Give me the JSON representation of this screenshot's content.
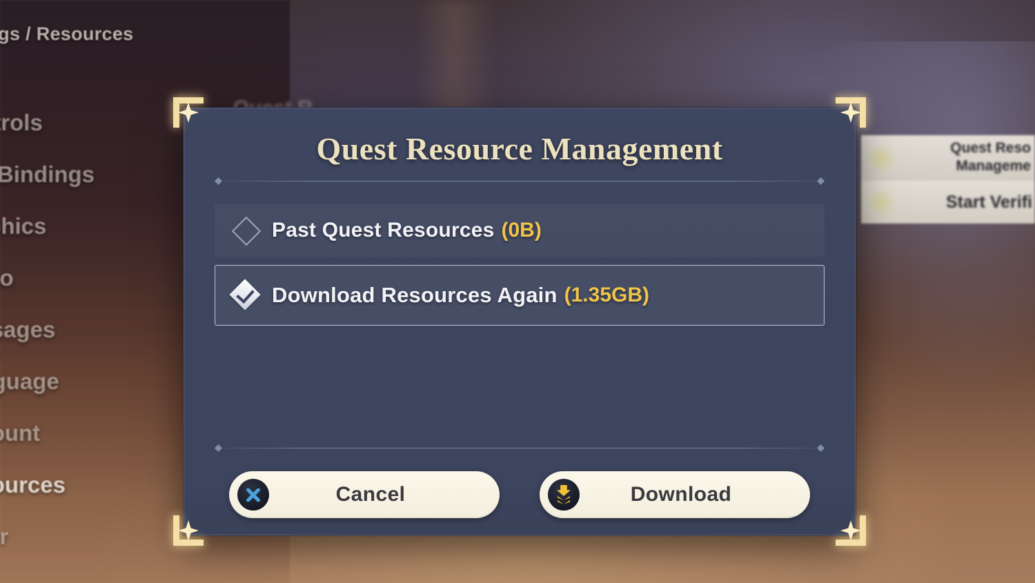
{
  "background": {
    "breadcrumb": "ttings / Resources",
    "ghost_heading": "Quest R",
    "sidebar": [
      {
        "label": "ontrols",
        "active": false
      },
      {
        "label": "ey Bindings",
        "active": false
      },
      {
        "label": "raphics",
        "active": false
      },
      {
        "label": "udio",
        "active": false
      },
      {
        "label": "essages",
        "active": false
      },
      {
        "label": "anguage",
        "active": false
      },
      {
        "label": "ccount",
        "active": false
      },
      {
        "label": "esources",
        "active": true
      },
      {
        "label": "ther",
        "active": false
      }
    ],
    "right_panel": {
      "quest_line1": "Quest Reso",
      "quest_line2": "Manageme",
      "verify_label": "Start Verifi"
    }
  },
  "dialog": {
    "title": "Quest Resource Management",
    "options": [
      {
        "label": "Past Quest Resources",
        "size": "(0B)",
        "checked": false
      },
      {
        "label": "Download Resources Again",
        "size": "(1.35GB)",
        "checked": true
      }
    ],
    "buttons": {
      "cancel": "Cancel",
      "download": "Download"
    }
  },
  "colors": {
    "dialog_bg": "#3d4560",
    "title_cream": "#ece1bf",
    "size_gold": "#f0c44a",
    "corner_gold": "#f4dfa6",
    "button_cream": "#f6f1e2",
    "cancel_blue": "#4ba3de",
    "download_gold": "#f3c233"
  }
}
